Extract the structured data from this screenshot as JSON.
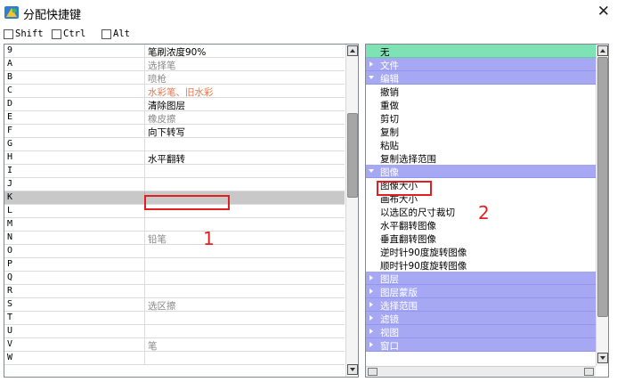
{
  "window": {
    "title": "分配快捷键",
    "close_glyph": "✕",
    "app_icon": "color-palette-icon"
  },
  "modifiers": [
    {
      "label": "Shift",
      "checked": false
    },
    {
      "label": "Ctrl",
      "checked": false
    },
    {
      "label": "Alt",
      "checked": false
    }
  ],
  "left_list": {
    "rows": [
      {
        "key": "9",
        "action": "笔刷浓度90%",
        "style": "normal"
      },
      {
        "key": "A",
        "action": "选择笔",
        "style": "gray"
      },
      {
        "key": "B",
        "action": "喷枪",
        "style": "gray"
      },
      {
        "key": "C",
        "action": "水彩笔、旧水彩",
        "style": "orange"
      },
      {
        "key": "D",
        "action": "清除图层",
        "style": "normal"
      },
      {
        "key": "E",
        "action": "橡皮擦",
        "style": "gray"
      },
      {
        "key": "F",
        "action": "向下转写",
        "style": "normal"
      },
      {
        "key": "G",
        "action": "",
        "style": "normal"
      },
      {
        "key": "H",
        "action": "水平翻转",
        "style": "normal"
      },
      {
        "key": "I",
        "action": "",
        "style": "normal"
      },
      {
        "key": "J",
        "action": "",
        "style": "normal"
      },
      {
        "key": "K",
        "action": "",
        "style": "normal",
        "selected": true
      },
      {
        "key": "L",
        "action": "",
        "style": "normal"
      },
      {
        "key": "M",
        "action": "",
        "style": "normal"
      },
      {
        "key": "N",
        "action": "铅笔",
        "style": "gray"
      },
      {
        "key": "O",
        "action": "",
        "style": "normal"
      },
      {
        "key": "P",
        "action": "",
        "style": "normal"
      },
      {
        "key": "Q",
        "action": "",
        "style": "normal"
      },
      {
        "key": "R",
        "action": "",
        "style": "normal"
      },
      {
        "key": "S",
        "action": "选区擦",
        "style": "gray"
      },
      {
        "key": "T",
        "action": "",
        "style": "normal"
      },
      {
        "key": "U",
        "action": "",
        "style": "normal"
      },
      {
        "key": "V",
        "action": "笔",
        "style": "gray"
      },
      {
        "key": "W",
        "action": "",
        "style": "normal"
      }
    ],
    "annotation": "1"
  },
  "right_list": {
    "rows": [
      {
        "kind": "none",
        "label": "无"
      },
      {
        "kind": "cat",
        "label": "文件",
        "expanded": false
      },
      {
        "kind": "cat",
        "label": "编辑",
        "expanded": true
      },
      {
        "kind": "item",
        "label": "撤销"
      },
      {
        "kind": "item",
        "label": "重做"
      },
      {
        "kind": "item",
        "label": "剪切"
      },
      {
        "kind": "item",
        "label": "复制"
      },
      {
        "kind": "item",
        "label": "粘贴"
      },
      {
        "kind": "item",
        "label": "复制选择范围"
      },
      {
        "kind": "cat",
        "label": "图像",
        "expanded": true
      },
      {
        "kind": "item",
        "label": "图像大小",
        "highlight": true
      },
      {
        "kind": "item",
        "label": "画布大小"
      },
      {
        "kind": "item",
        "label": "以选区的尺寸裁切"
      },
      {
        "kind": "item",
        "label": "水平翻转图像"
      },
      {
        "kind": "item",
        "label": "垂直翻转图像"
      },
      {
        "kind": "item",
        "label": "逆时针90度旋转图像"
      },
      {
        "kind": "item",
        "label": "顺时针90度旋转图像"
      },
      {
        "kind": "cat",
        "label": "图层",
        "expanded": false
      },
      {
        "kind": "cat",
        "label": "图层蒙版",
        "expanded": false
      },
      {
        "kind": "cat",
        "label": "选择范围",
        "expanded": false
      },
      {
        "kind": "cat",
        "label": "滤镜",
        "expanded": false
      },
      {
        "kind": "cat",
        "label": "视图",
        "expanded": false
      },
      {
        "kind": "cat",
        "label": "窗口",
        "expanded": false
      }
    ],
    "annotation": "2"
  },
  "colors": {
    "none_row": "#7ee2b4",
    "category_row": "#a6a8f4",
    "selected_row": "#c8c8c8",
    "annotation_red": "#e02020"
  }
}
